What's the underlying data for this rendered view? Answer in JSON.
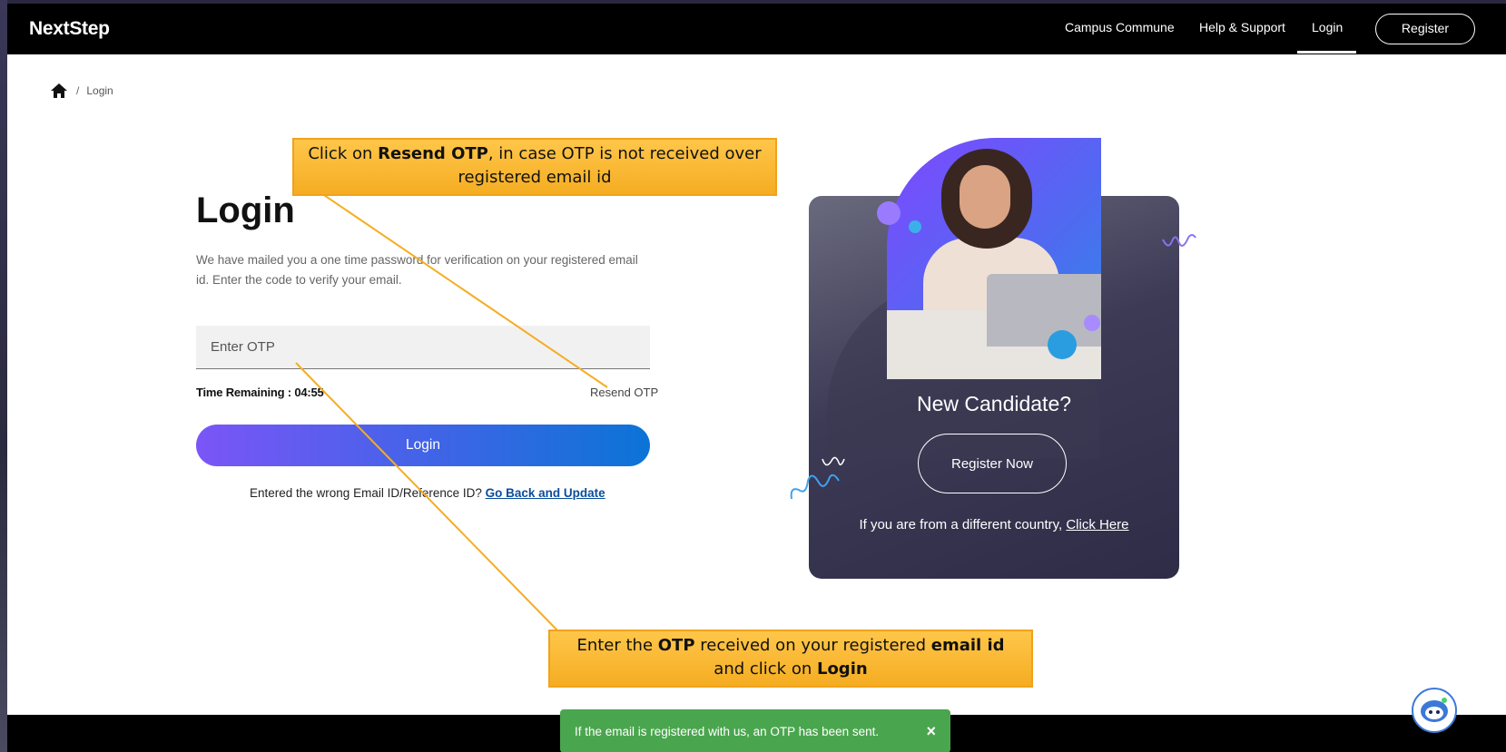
{
  "header": {
    "logo": "NextStep",
    "nav": {
      "campus_commune": "Campus Commune",
      "help_support": "Help & Support",
      "login": "Login",
      "register": "Register"
    }
  },
  "breadcrumb": {
    "current": "Login"
  },
  "login_form": {
    "title": "Login",
    "description": "We have mailed you a one time password for verification on your registered email id. Enter the code to verify your email.",
    "otp_placeholder": "Enter OTP",
    "time_remaining": "Time Remaining : 04:55",
    "resend_otp": "Resend OTP",
    "login_button": "Login",
    "wrong_email_text": "Entered the wrong Email ID/Reference ID?",
    "go_back_link": "Go Back and Update"
  },
  "candidate_card": {
    "title": "New Candidate?",
    "register_now": "Register Now",
    "country_text": "If you are from a different country,",
    "click_here": "Click Here"
  },
  "annotations": {
    "top": {
      "pre": "Click on ",
      "bold": "Resend OTP",
      "post": ", in case OTP is not received over registered email id"
    },
    "bottom": {
      "pre": "Enter the ",
      "bold1": "OTP",
      "mid": " received on your registered ",
      "bold2": "email id",
      "mid2": " and click on ",
      "bold3": "Login"
    }
  },
  "toast": {
    "message": "If the email is registered with us, an OTP has been sent.",
    "close": "×"
  },
  "colors": {
    "accent_start": "#7b55f7",
    "accent_end": "#0b74d6",
    "toast": "#4aa64e",
    "callout": "#f5ad22"
  }
}
